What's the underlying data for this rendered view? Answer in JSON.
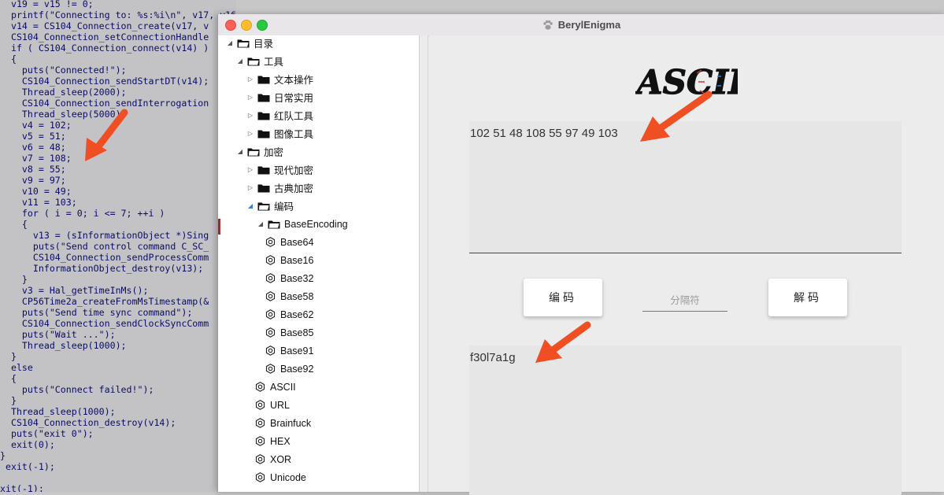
{
  "code_view": {
    "lines": [
      {
        "text": "  v19 = v15 != 0;"
      },
      {
        "text": "  printf(\"Connecting to: %s:%i\\n\", v17, v16);"
      },
      {
        "text": "  v14 = CS104_Connection_create(v17, v"
      },
      {
        "text": "  CS104_Connection_setConnectionHandle"
      },
      {
        "text": "  if ( CS104_Connection_connect(v14) )"
      },
      {
        "text": "  {"
      },
      {
        "text": "    puts(\"Connected!\");"
      },
      {
        "text": "    CS104_Connection_sendStartDT(v14);"
      },
      {
        "text": "    Thread_sleep(2000);"
      },
      {
        "text": "    CS104_Connection_sendInterrogation"
      },
      {
        "text": "    Thread_sleep(5000);"
      },
      {
        "text": "    v4 = 102;"
      },
      {
        "text": "    v5 = 51;"
      },
      {
        "text": "    v6 = 48;"
      },
      {
        "text": "    v7 = 108;"
      },
      {
        "text": "    v8 = 55;"
      },
      {
        "text": "    v9 = 97;"
      },
      {
        "text": "    v10 = 49;"
      },
      {
        "text": "    v11 = 103;"
      },
      {
        "text": "    for ( i = 0; i <= 7; ++i )"
      },
      {
        "text": "    {"
      },
      {
        "text": "      v13 = (sInformationObject *)Sing"
      },
      {
        "text": "      puts(\"Send control command C_SC_"
      },
      {
        "text": "      CS104_Connection_sendProcessComm"
      },
      {
        "text": "      InformationObject_destroy(v13);"
      },
      {
        "text": "    }"
      },
      {
        "text": "    v3 = Hal_getTimeInMs();"
      },
      {
        "text": "    CP56Time2a_createFromMsTimestamp(&"
      },
      {
        "text": "    puts(\"Send time sync command\");"
      },
      {
        "text": "    CS104_Connection_sendClockSyncComm"
      },
      {
        "text": "    puts(\"Wait ...\");"
      },
      {
        "text": "    Thread_sleep(1000);"
      },
      {
        "text": "  }"
      },
      {
        "text": "  else"
      },
      {
        "text": "  {"
      },
      {
        "text": "    puts(\"Connect failed!\");"
      },
      {
        "text": "  }"
      },
      {
        "text": "  Thread_sleep(1000);"
      },
      {
        "text": "  CS104_Connection_destroy(v14);"
      },
      {
        "text": "  puts(\"exit 0\");"
      },
      {
        "text": "  exit(0);"
      },
      {
        "text": "}"
      },
      {
        "text": " exit(-1);"
      },
      {
        "text": ""
      },
      {
        "text": "xit(-1);"
      }
    ]
  },
  "window": {
    "title": "BerylEnigma"
  },
  "tree": {
    "items": [
      {
        "label": "目录",
        "kind": "folder",
        "expanded": true
      },
      {
        "label": "工具",
        "kind": "folder",
        "expanded": true
      },
      {
        "label": "文本操作",
        "kind": "folder",
        "expanded": false
      },
      {
        "label": "日常实用",
        "kind": "folder",
        "expanded": false
      },
      {
        "label": "红队工具",
        "kind": "folder",
        "expanded": false
      },
      {
        "label": "图像工具",
        "kind": "folder",
        "expanded": false
      },
      {
        "label": "加密",
        "kind": "folder",
        "expanded": true
      },
      {
        "label": "现代加密",
        "kind": "folder",
        "expanded": false
      },
      {
        "label": "古典加密",
        "kind": "folder",
        "expanded": false
      },
      {
        "label": "编码",
        "kind": "folder",
        "expanded": true
      },
      {
        "label": "BaseEncoding",
        "kind": "folder",
        "expanded": true
      },
      {
        "label": "Base64",
        "kind": "leaf"
      },
      {
        "label": "Base16",
        "kind": "leaf"
      },
      {
        "label": "Base32",
        "kind": "leaf"
      },
      {
        "label": "Base58",
        "kind": "leaf"
      },
      {
        "label": "Base62",
        "kind": "leaf"
      },
      {
        "label": "Base85",
        "kind": "leaf"
      },
      {
        "label": "Base91",
        "kind": "leaf"
      },
      {
        "label": "Base92",
        "kind": "leaf"
      },
      {
        "label": "ASCII",
        "kind": "leaf"
      },
      {
        "label": "URL",
        "kind": "leaf"
      },
      {
        "label": "Brainfuck",
        "kind": "leaf"
      },
      {
        "label": "HEX",
        "kind": "leaf"
      },
      {
        "label": "XOR",
        "kind": "leaf"
      },
      {
        "label": "Unicode",
        "kind": "leaf"
      }
    ]
  },
  "main": {
    "heading": "ASCII",
    "input_text": "102 51 48 108 55 97 49 103",
    "encode_label": "编码",
    "separator_placeholder": "分隔符",
    "decode_label": "解码",
    "output_text": "f30l7a1g"
  },
  "colors": {
    "annotation_arrow": "#f04e23",
    "close": "#fe5f57",
    "minimize": "#febc2e",
    "maximize": "#28c840"
  }
}
